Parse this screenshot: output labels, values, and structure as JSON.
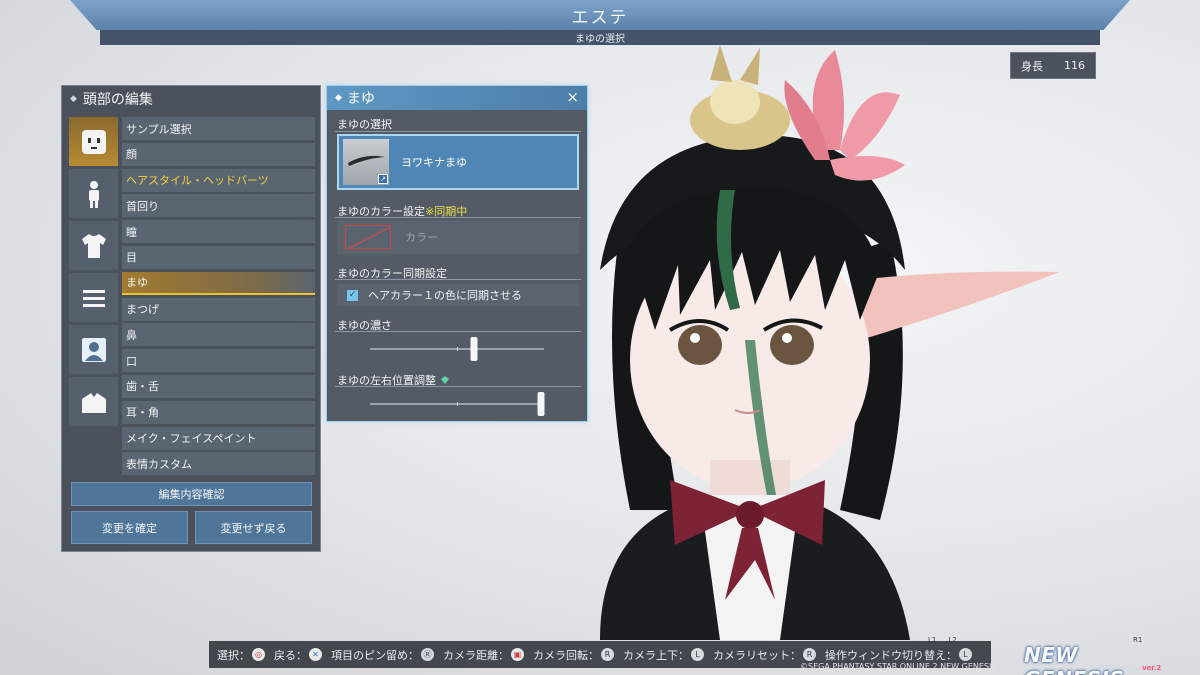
{
  "header": {
    "title": "エステ",
    "subtitle": "まゆの選択"
  },
  "height_display": {
    "label": "身長",
    "value": "116"
  },
  "left_panel": {
    "title": "頭部の編集",
    "category_icons": [
      "face-icon",
      "body-icon",
      "clothes-icon",
      "menu-lines-icon",
      "portrait-icon",
      "accessory-icon"
    ],
    "menu": [
      "サンプル選択",
      "顔",
      "ヘアスタイル・ヘッドパーツ",
      "首回り",
      "瞳",
      "目",
      "まゆ",
      "まつげ",
      "鼻",
      "口",
      "歯・舌",
      "耳・角",
      "メイク・フェイスペイント",
      "表情カスタム"
    ],
    "selected_index": 6,
    "highlight_index": 2,
    "confirm_edit_label": "編集内容確認",
    "apply_label": "変更を確定",
    "discard_label": "変更せず戻る"
  },
  "mid_panel": {
    "title": "まゆ",
    "close_label": "×",
    "selection_label": "まゆの選択",
    "selected_eyebrow": "ヨワキナまゆ",
    "thumb_badge": "↗",
    "color_setting_label": "まゆのカラー設定",
    "color_sync_note": "※同期中",
    "color_button_label": "カラー",
    "sync_setting_label": "まゆのカラー同期設定",
    "sync_checkbox_label": "ヘアカラー１の色に同期させる",
    "sync_checked": true,
    "density_label": "まゆの濃さ",
    "density_value": 0.6,
    "position_label": "まゆの左右位置調整",
    "position_value": 0.98
  },
  "controls_bar": [
    {
      "label": "選択：",
      "glyph": "◎",
      "style": "red"
    },
    {
      "label": "戻る：",
      "glyph": "✕",
      "style": "blue"
    },
    {
      "label": "項目のピン留め：",
      "glyph": "Ⓡ",
      "style": ""
    },
    {
      "label": "カメラ距離：",
      "glyph": "▣",
      "style": "red"
    },
    {
      "label": "カメラ回転：",
      "glyph": "R",
      "style": ""
    },
    {
      "label": "カメラ上下：",
      "glyph": "L",
      "style": ""
    },
    {
      "label": "カメラリセット：",
      "glyph": "R",
      "style": ""
    },
    {
      "label": "操作ウィンドウ切り替え：",
      "glyph": "L",
      "style": ""
    }
  ],
  "copyright": "©SEGA PHANTASY STAR ONLINE 2 NEW GENESIS",
  "logo": "NEW GENESIS",
  "logo_sub": "ver.2",
  "corner_hints": [
    "L1",
    "L2"
  ],
  "right_hint": "R1",
  "colors": {
    "accent_blue": "#4f86b5",
    "selected_gold": "#f2c12e",
    "sync_yellow": "#e7e245"
  }
}
